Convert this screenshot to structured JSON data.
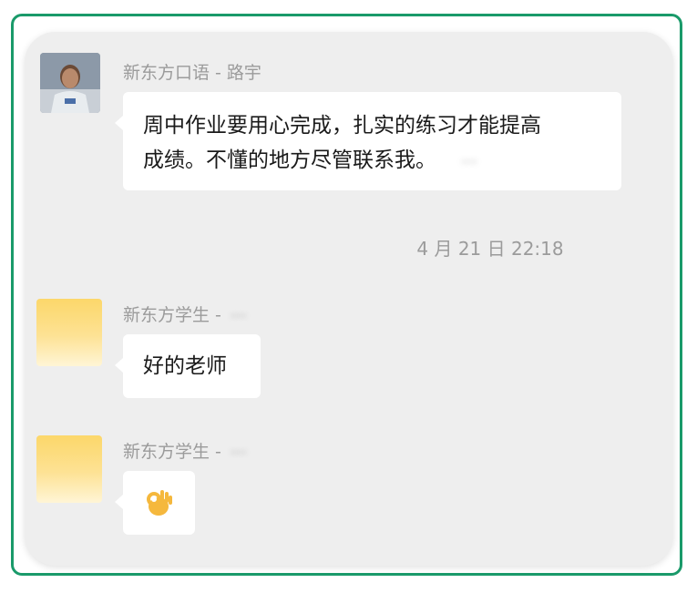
{
  "messages": [
    {
      "sender": "新东方口语 - 路宇",
      "text_line1": "周中作业要用心完成，扎实的练习才能提高",
      "text_line2": "成绩。不懂的地方尽管联系我。",
      "redacted_tail": "···",
      "avatar": "teacher-photo"
    },
    {
      "sender": "新东方学生 -",
      "redacted_name": "···",
      "text": "好的老师",
      "avatar": "yellow-gradient"
    },
    {
      "sender": "新东方学生 -",
      "redacted_name": "···",
      "emoji": "ok-hand-emoji",
      "avatar": "yellow-gradient"
    }
  ],
  "timestamp": "4 月 21 日 22:18",
  "colors": {
    "frame_border": "#1a9a6a",
    "panel_bg": "#eeeeee",
    "bubble_bg": "#ffffff",
    "meta_text": "#9b9b9b"
  }
}
